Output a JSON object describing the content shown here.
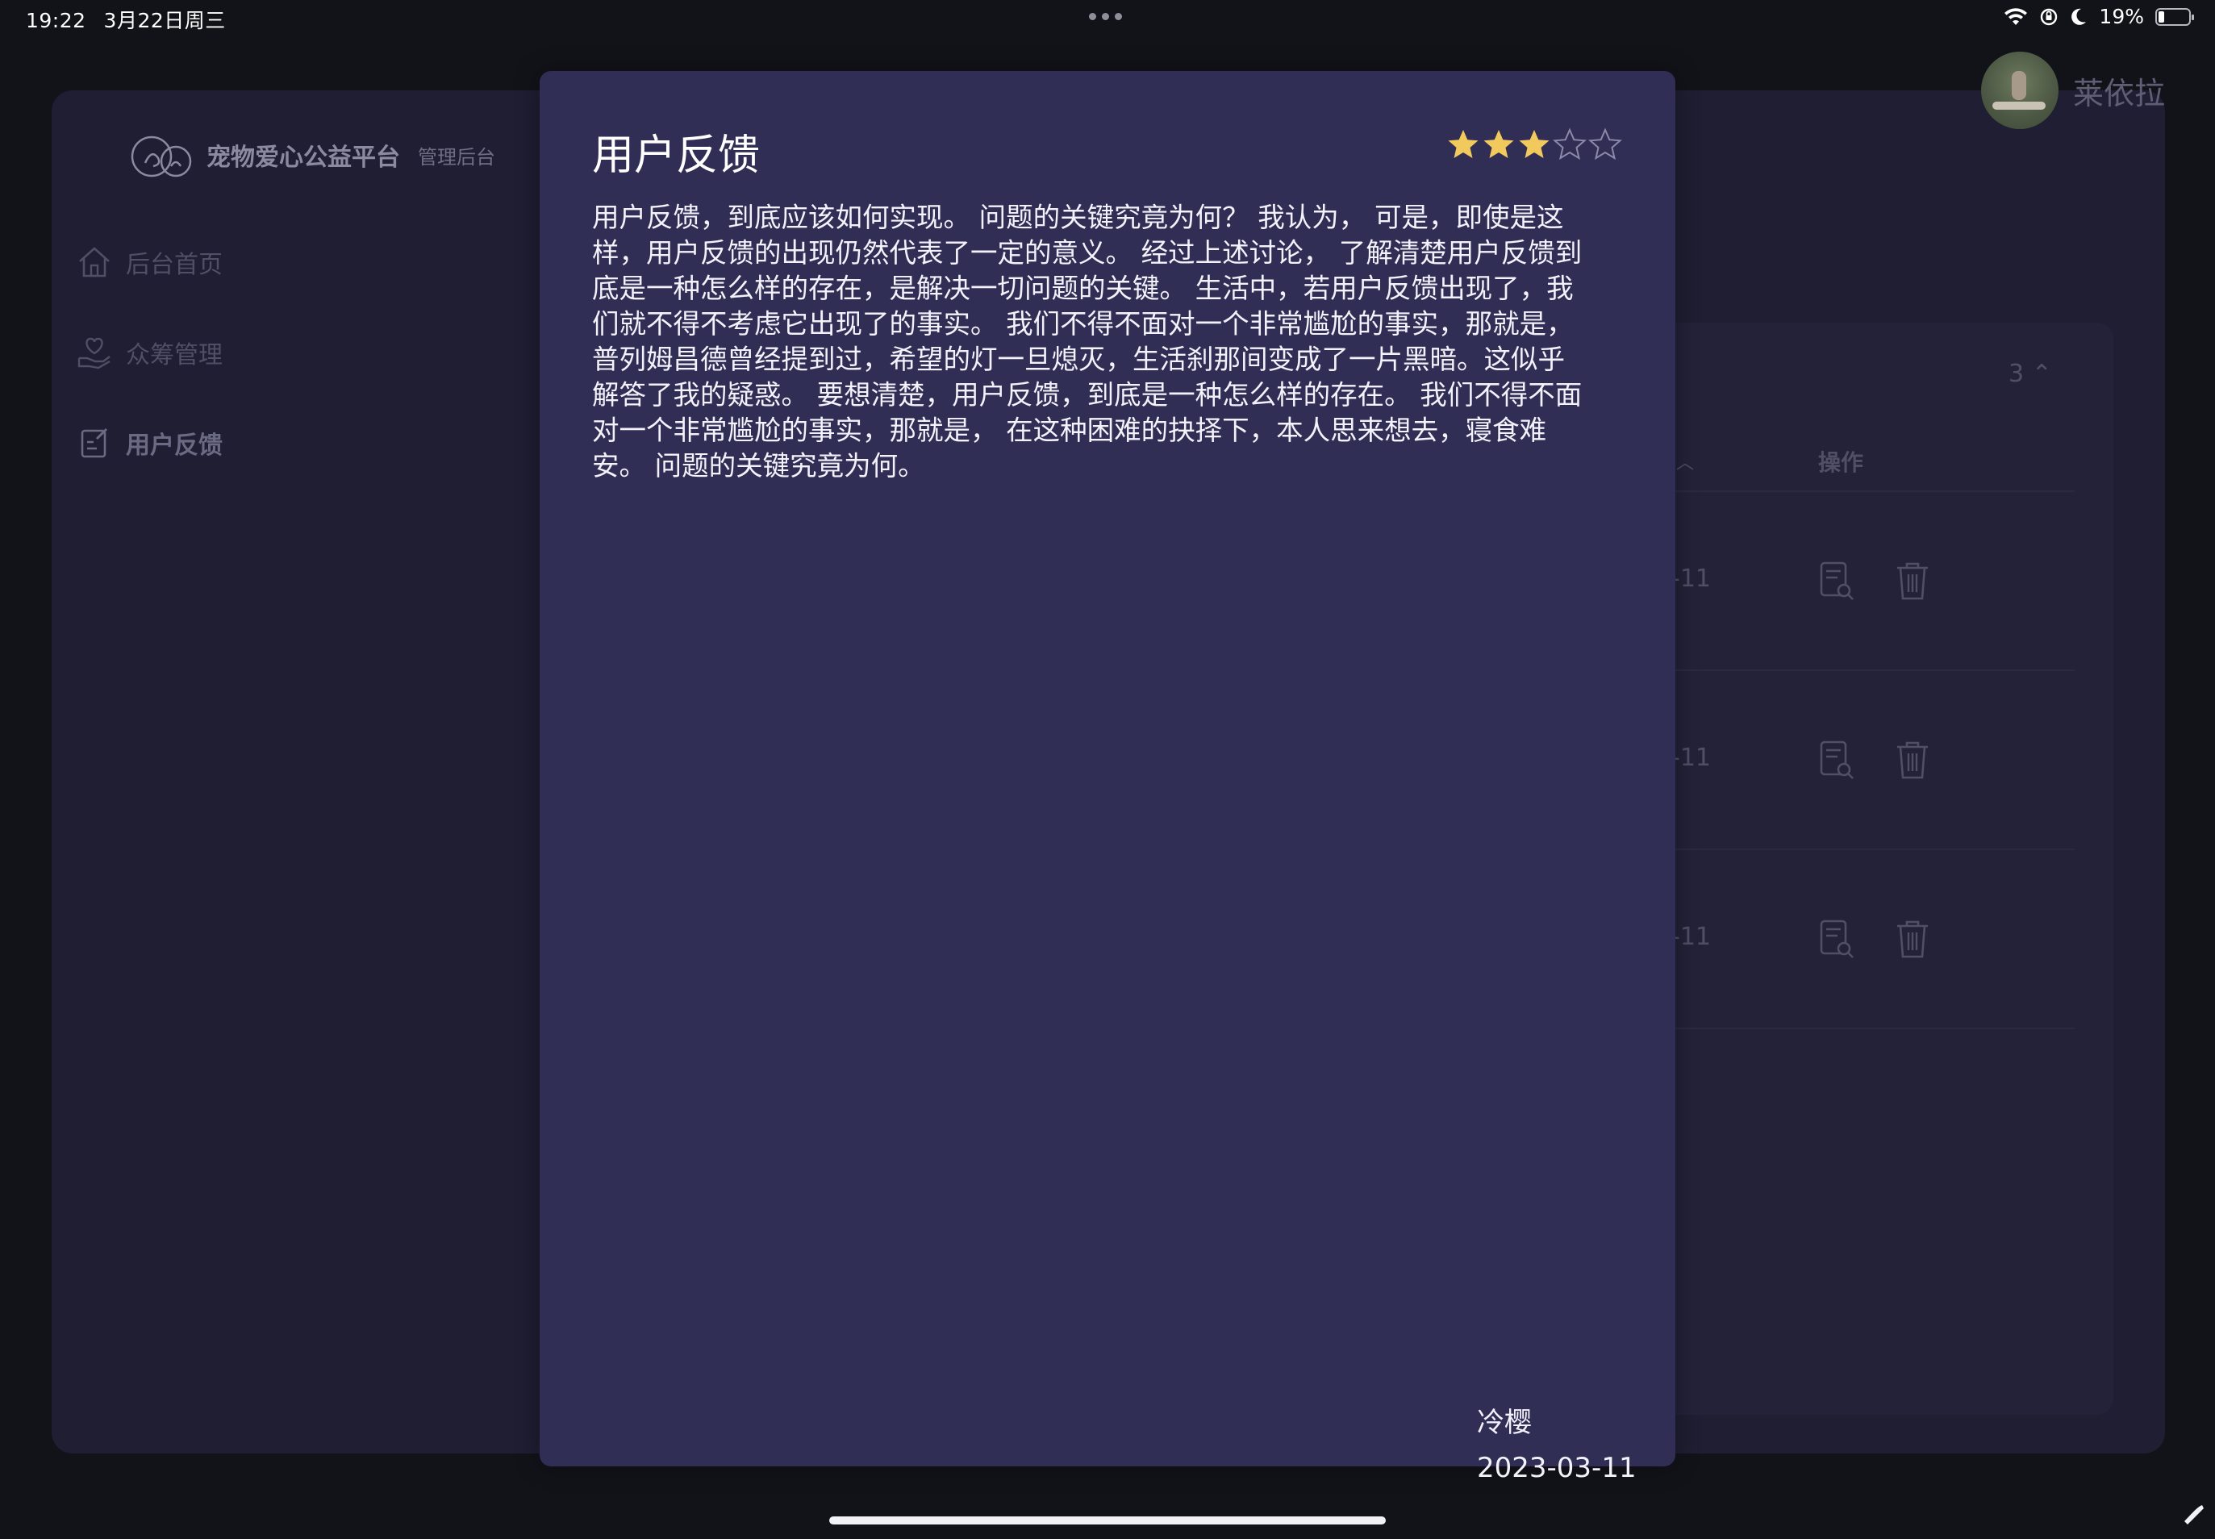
{
  "status_bar": {
    "time": "19:22",
    "date": "3月22日周三",
    "battery_text": "19%",
    "battery_level": 0.19,
    "icons": [
      "wifi-icon",
      "orientation-lock-icon",
      "moon-icon",
      "battery-icon"
    ]
  },
  "sidebar": {
    "brand_title": "宠物爱心公益平台",
    "brand_sub": "管理后台",
    "items": [
      {
        "label": "后台首页",
        "icon": "home-icon"
      },
      {
        "label": "众筹管理",
        "icon": "heart-hand-icon"
      },
      {
        "label": "用户反馈",
        "icon": "edit-note-icon"
      }
    ]
  },
  "header": {
    "user_name": "莱依拉"
  },
  "table": {
    "page_size": "3",
    "column_operation": "操作",
    "rows": [
      {
        "date_fragment": "-11"
      },
      {
        "date_fragment": "-11"
      },
      {
        "date_fragment": "-11"
      }
    ]
  },
  "modal": {
    "title": "用户反馈",
    "rating": 3,
    "rating_max": 5,
    "body_lines": [
      "用户反馈，到底应该如何实现。 问题的关键究竟为何？ 我认为， 可是，即使是这",
      "样，用户反馈的出现仍然代表了一定的意义。 经过上述讨论， 了解清楚用户反馈到",
      "底是一种怎么样的存在，是解决一切问题的关键。 生活中，若用户反馈出现了，我",
      "们就不得不考虑它出现了的事实。 我们不得不面对一个非常尴尬的事实，那就是，",
      "普列姆昌德曾经提到过，希望的灯一旦熄灭，生活刹那间变成了一片黑暗。这似乎",
      "解答了我的疑惑。 要想清楚，用户反馈，到底是一种怎么样的存在。 我们不得不面",
      "对一个非常尴尬的事实，那就是， 在这种困难的抉择下，本人思来想去，寝食难",
      "安。 问题的关键究竟为何。"
    ],
    "author": "冷樱",
    "date": "2023-03-11"
  },
  "colors": {
    "modal_bg": "#312e56",
    "star_filled": "#f2c95c",
    "star_empty": "#8d8aa8"
  }
}
